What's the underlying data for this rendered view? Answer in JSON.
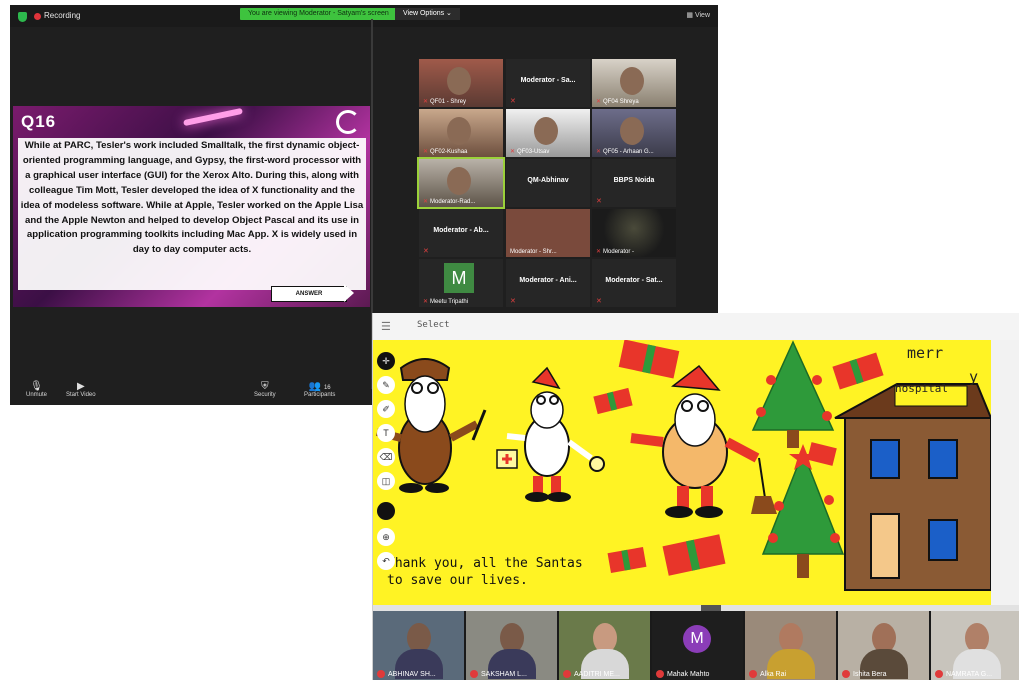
{
  "zoom": {
    "recording_label": "Recording",
    "viewing_banner": "You are viewing Moderator - Satyam's screen",
    "view_options": "View Options ⌄",
    "view_button": "▦ View",
    "slide": {
      "question_number": "Q16",
      "question_text": "While at PARC, Tesler's work included Smalltalk, the first dynamic object-oriented programming language, and Gypsy, the first-word processor with a graphical user interface (GUI) for the Xerox Alto. During this, along with colleague Tim Mott, Tesler developed the idea of X functionality and the idea of modeless software. While at Apple, Tesler worked on the Apple Lisa and the Apple Newton and helped to develop Object Pascal and its use in application programming toolkits including Mac App. X is widely used in day to day computer acts.",
      "answer_label": "ANSWER"
    },
    "participants": [
      {
        "name": "QF01 - Shrey",
        "type": "video"
      },
      {
        "name": "Moderator - Sa...",
        "type": "title"
      },
      {
        "name": "QF04 Shreya",
        "type": "video"
      },
      {
        "name": "QF02-Kushaa",
        "type": "video"
      },
      {
        "name": "QF03-Utsav",
        "type": "video"
      },
      {
        "name": "QF05 - Arhaan G...",
        "type": "video"
      },
      {
        "name": "Moderator-Rad...",
        "type": "video"
      },
      {
        "name": "QM-Abhinav",
        "type": "title"
      },
      {
        "name": "BBPS Noida",
        "type": "title"
      },
      {
        "name": "Moderator - Ab...",
        "type": "title"
      },
      {
        "name": "Moderator - Shr...",
        "type": "video"
      },
      {
        "name": "Moderator -",
        "type": "video"
      },
      {
        "name": "Meetu Tripathi",
        "type": "avatar",
        "initial": "M"
      },
      {
        "name": "Moderator - Ani...",
        "type": "title"
      },
      {
        "name": "Moderator - Sat...",
        "type": "title"
      }
    ],
    "controls": {
      "unmute": "Unmute",
      "start_video": "Start Video",
      "security": "Security",
      "participants": "Participants",
      "participant_count": "16"
    }
  },
  "whiteboard": {
    "menu_icon": "hamburger-icon",
    "mode_label": "Select",
    "merry_1": "merr",
    "merry_2": "y",
    "hospital_label": "hospital",
    "thanks_text": "Thank you, all the Santas\nto save our lives.",
    "tools": [
      "move",
      "pen",
      "pencil",
      "text",
      "eraser",
      "shapes",
      "color",
      "zoom",
      "undo"
    ],
    "colors": {
      "canvas": "#fff324",
      "accent_red": "#e8352a",
      "tree_green": "#2e9a3a"
    }
  },
  "video_strip": [
    {
      "name": "ABHINAV SH..."
    },
    {
      "name": "SAKSHAM L..."
    },
    {
      "name": "AADITRI ME..."
    },
    {
      "name": "Mahak Mahto",
      "initial": "M"
    },
    {
      "name": "Alka Rai"
    },
    {
      "name": "Ishita Bera"
    },
    {
      "name": "NAMRATA G..."
    }
  ]
}
